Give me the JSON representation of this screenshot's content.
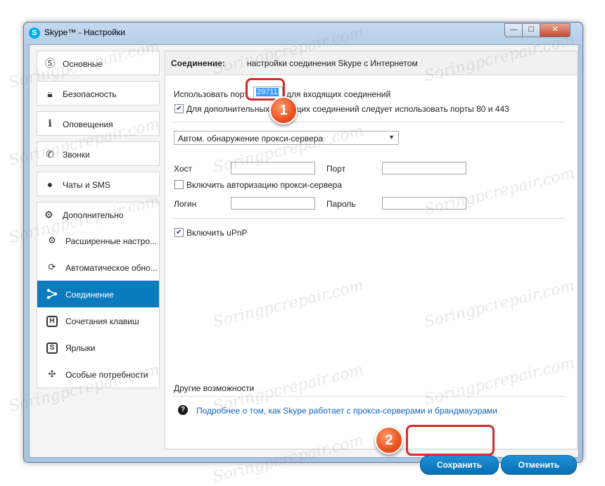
{
  "window": {
    "title": "Skype™ - Настройки",
    "controls": {
      "minimize": "—",
      "maximize": "☐",
      "close": "✕"
    }
  },
  "sidebar": {
    "categories": [
      {
        "label": "Основные",
        "icon": "skype-icon"
      },
      {
        "label": "Безопасность",
        "icon": "lock-icon"
      },
      {
        "label": "Оповещения",
        "icon": "info-icon"
      },
      {
        "label": "Звонки",
        "icon": "phone-icon"
      },
      {
        "label": "Чаты и SMS",
        "icon": "chat-icon"
      }
    ],
    "advanced": {
      "label": "Дополнительно",
      "icon": "gear-icon",
      "items": [
        {
          "label": "Расширенные настро...",
          "icon": "gear-icon"
        },
        {
          "label": "Автоматическое обно...",
          "icon": "refresh-icon"
        },
        {
          "label": "Соединение",
          "icon": "connection-icon",
          "active": true
        },
        {
          "label": "Сочетания клавиш",
          "icon": "hotkey-icon",
          "glyph": "H"
        },
        {
          "label": "Ярлыки",
          "icon": "shortcut-icon",
          "glyph": "S"
        },
        {
          "label": "Особые потребности",
          "icon": "accessibility-icon"
        }
      ]
    }
  },
  "panel": {
    "header_strong": "Соединение:",
    "header_rest": "настройки соединения Skype с Интернетом",
    "port_label_before": "Использовать порт",
    "port_value": "29711",
    "port_label_after": "для входящих соединений",
    "alt_ports_label": "Для дополнительных входящих соединений следует использовать порты 80 и 443",
    "alt_ports_checked": true,
    "proxy_select": "Автом. обнаружение прокси-сервера",
    "host_label": "Хост",
    "port_field_label": "Порт",
    "proxy_auth_label": "Включить авторизацию прокси-сервера",
    "proxy_auth_checked": false,
    "login_label": "Логин",
    "password_label": "Пароль",
    "upnp_label": "Включить uPnP",
    "upnp_checked": true,
    "other_label": "Другие возможности",
    "help_link": "Подробнее о том, как Skype работает с прокси-серверами и брандмауэрами"
  },
  "buttons": {
    "save": "Сохранить",
    "cancel": "Отменить"
  },
  "annotations": {
    "badge1": "1",
    "badge2": "2"
  },
  "watermark": "Soringpcrepair.com",
  "colors": {
    "accent": "#0a7bbd",
    "callout": "#d92a2a",
    "badge": "#e8531e"
  }
}
